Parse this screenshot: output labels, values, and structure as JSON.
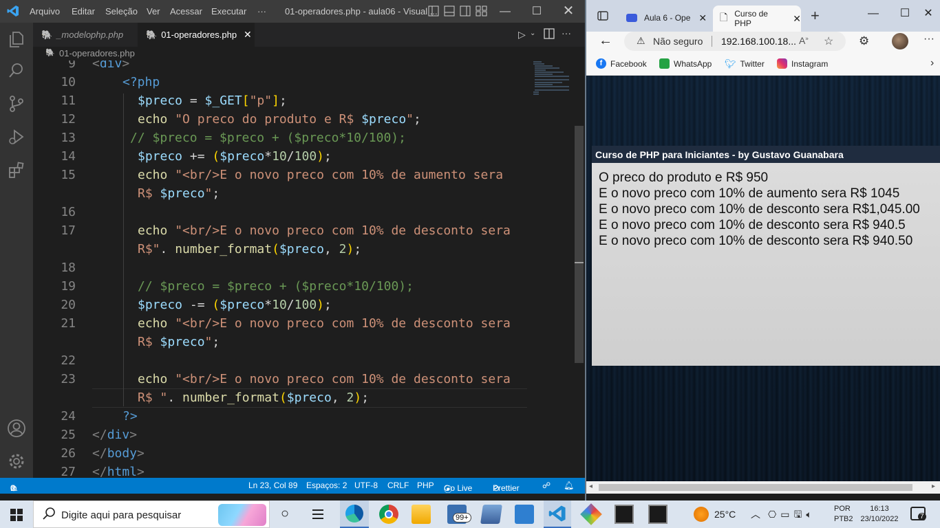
{
  "vscode": {
    "menu": [
      "Arquivo",
      "Editar",
      "Seleção",
      "Ver",
      "Acessar",
      "Executar",
      "···"
    ],
    "window_title": "01-operadores.php - aula06 - Visual ...",
    "tabs": [
      {
        "label": "_modelophp.php",
        "active": false
      },
      {
        "label": "01-operadores.php",
        "active": true
      }
    ],
    "breadcrumb": "01-operadores.php",
    "code_lines": [
      {
        "n": "9",
        "text": "<div>"
      },
      {
        "n": "10",
        "text": "<?php"
      },
      {
        "n": "11",
        "text": "$preco = $_GET[\"p\"];"
      },
      {
        "n": "12",
        "text": "echo \"O preco do produto e R$ $preco\";"
      },
      {
        "n": "13",
        "text": "// $preco = $preco + ($preco*10/100);"
      },
      {
        "n": "14",
        "text": "$preco += ($preco*10/100);"
      },
      {
        "n": "15",
        "text": "echo \"<br/>E o novo preco com 10% de aumento sera R$ $preco\";"
      },
      {
        "n": "16",
        "text": ""
      },
      {
        "n": "17",
        "text": "echo \"<br/>E o novo preco com 10% de desconto sera R$\". number_format($preco, 2);"
      },
      {
        "n": "18",
        "text": ""
      },
      {
        "n": "19",
        "text": "// $preco = $preco + ($preco*10/100);"
      },
      {
        "n": "20",
        "text": "$preco -= ($preco*10/100);"
      },
      {
        "n": "21",
        "text": "echo \"<br/>E o novo preco com 10% de desconto sera R$ $preco\";"
      },
      {
        "n": "22",
        "text": ""
      },
      {
        "n": "23",
        "text": "echo \"<br/>E o novo preco com 10% de desconto sera R$ \". number_format($preco, 2);"
      },
      {
        "n": "24",
        "text": "?>"
      },
      {
        "n": "25",
        "text": "</div>"
      },
      {
        "n": "26",
        "text": "</body>"
      },
      {
        "n": "27",
        "text": "</html>"
      }
    ],
    "status": {
      "errors": "0",
      "warnings": "0",
      "position": "Ln 23, Col 89",
      "spaces": "Espaços: 2",
      "encoding": "UTF-8",
      "eol": "CRLF",
      "language": "PHP",
      "golive": "Go Live",
      "prettier": "Prettier"
    }
  },
  "edge": {
    "tabs": [
      {
        "label": "Aula 6 - Ope",
        "active": false
      },
      {
        "label": "Curso de PHP",
        "active": true
      }
    ],
    "security": "Não seguro",
    "url": "192.168.100.18...",
    "bookmarks": [
      "Facebook",
      "WhatsApp",
      "Twitter",
      "Instagram"
    ],
    "page": {
      "header": "Curso de PHP para Iniciantes - by Gustavo Guanabara",
      "lines": [
        "O preco do produto e R$ 950",
        "E o novo preco com 10% de aumento sera R$ 1045",
        "E o novo preco com 10% de desconto sera R$1,045.00",
        "E o novo preco com 10% de desconto sera R$ 940.5",
        "E o novo preco com 10% de desconto sera R$ 940.50"
      ]
    }
  },
  "taskbar": {
    "search_placeholder": "Digite aqui para pesquisar",
    "badge": "99+",
    "weather": "25°C",
    "language": "POR",
    "layout": "PTB2",
    "time": "16:13",
    "date": "23/10/2022",
    "notifications": "7"
  }
}
